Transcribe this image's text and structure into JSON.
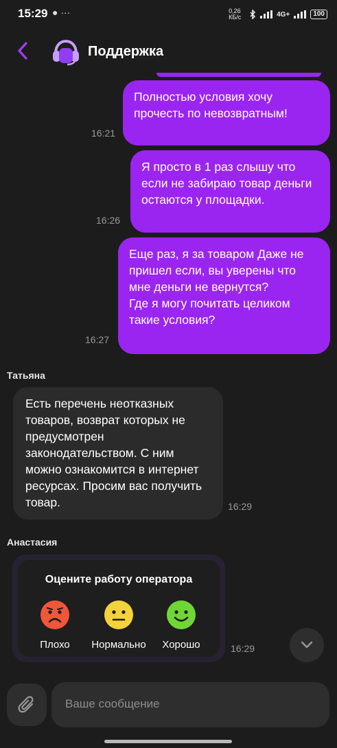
{
  "status_bar": {
    "time": "15:29",
    "left_icons": "● ···",
    "net_speed": "0,26 КБ/с",
    "network": "4G+",
    "battery": "100"
  },
  "header": {
    "back_icon": "chevron-left-icon",
    "avatar_icon": "headset-icon",
    "title": "Поддержка"
  },
  "messages": [
    {
      "type": "out",
      "time": "16:21",
      "text": "Полностью условия хочу прочесть по невозвратным!"
    },
    {
      "type": "out",
      "time": "16:26",
      "text": "Я просто в 1 раз слышу что если не забираю товар деньги остаются у площадки."
    },
    {
      "type": "out",
      "time": "16:27",
      "text": "Еще раз, я за товаром Даже не пришел если, вы уверены что мне деньги не вернутся?\nГде я могу почитать целиком такие условия?"
    },
    {
      "type": "in",
      "sender": "Татьяна",
      "time": "16:29",
      "text": "Есть перечень неотказных товаров, возврат которых не предусмотрен законодательством. С ним можно ознакомится в интернет ресурсах. Просим вас получить товар."
    }
  ],
  "rating": {
    "sender": "Анастасия",
    "title": "Оцените работу оператора",
    "time": "16:29",
    "options": [
      {
        "label": "Плохо",
        "icon": "sad-face-icon",
        "color": "#f0563a"
      },
      {
        "label": "Нормально",
        "icon": "neutral-face-icon",
        "color": "#f3d23c"
      },
      {
        "label": "Хорошо",
        "icon": "happy-face-icon",
        "color": "#6fd637"
      }
    ]
  },
  "composer": {
    "attach_icon": "paperclip-icon",
    "placeholder": "Ваше сообщение"
  },
  "colors": {
    "background": "#1c1c1c",
    "accent": "#9b25f0",
    "incoming_bubble": "#2b2b2b"
  }
}
